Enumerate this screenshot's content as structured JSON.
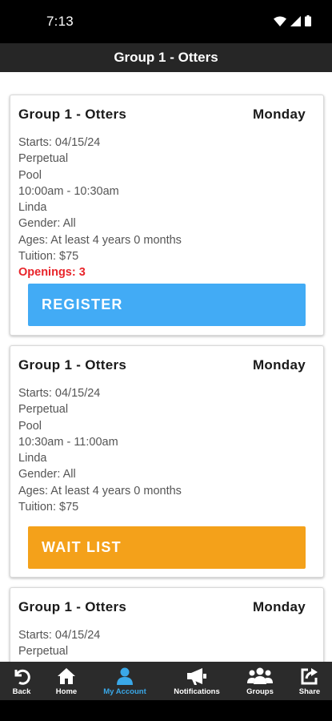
{
  "status": {
    "time": "7:13"
  },
  "header": {
    "title": "Group 1 - Otters"
  },
  "cards": [
    {
      "name": "Group 1 - Otters",
      "day": "Monday",
      "lines": [
        "Starts: 04/15/24",
        "Perpetual",
        "Pool",
        "10:00am - 10:30am",
        "Linda",
        "Gender: All",
        "Ages: At least 4 years 0 months",
        "Tuition: $75"
      ],
      "openings": "Openings: 3",
      "button_label": "REGISTER",
      "button_color": "#42abf5"
    },
    {
      "name": "Group 1 - Otters",
      "day": "Monday",
      "lines": [
        "Starts: 04/15/24",
        "Perpetual",
        "Pool",
        "10:30am - 11:00am",
        "Linda",
        "Gender: All",
        "Ages: At least 4 years 0 months",
        "Tuition: $75"
      ],
      "button_label": "WAIT LIST",
      "button_color": "#f4a11a"
    },
    {
      "name": "Group 1 - Otters",
      "day": "Monday",
      "lines": [
        "Starts: 04/15/24",
        "Perpetual"
      ]
    }
  ],
  "nav": {
    "items": [
      {
        "label": "Back",
        "icon": "back-icon"
      },
      {
        "label": "Home",
        "icon": "home-icon"
      },
      {
        "label": "My Account",
        "icon": "account-icon",
        "active": true
      },
      {
        "label": "Notifications",
        "icon": "megaphone-icon"
      },
      {
        "label": "Groups",
        "icon": "groups-icon"
      },
      {
        "label": "Share",
        "icon": "share-icon"
      }
    ],
    "active_color": "#3aa8e8"
  }
}
